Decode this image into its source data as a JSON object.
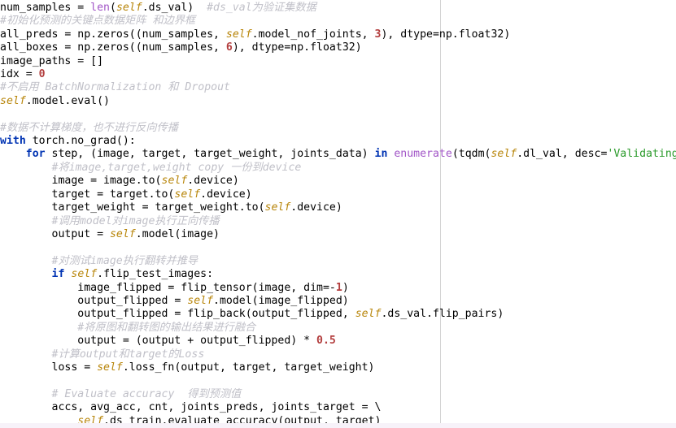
{
  "editor": {
    "app_name": "code-editor",
    "language": "python",
    "margin_ruler_column": 80,
    "colors": {
      "background": "#ffffff",
      "foreground": "#000000",
      "comment": "#c0c0c8",
      "keyword": "#0033b3",
      "self_variable": "#b8860b",
      "builtin": "#a256c7",
      "number": "#b33e3e",
      "string": "#2a9a2a",
      "ruler": "#d4d4d4",
      "bottom_band": "#f7f2f9"
    }
  },
  "code": {
    "lines": [
      [
        {
          "t": "num_samples = ",
          "c": "plain"
        },
        {
          "t": "len",
          "c": "builtin"
        },
        {
          "t": "(",
          "c": "plain"
        },
        {
          "t": "self",
          "c": "selfv"
        },
        {
          "t": ".ds_val)  ",
          "c": "plain"
        },
        {
          "t": "#ds_val为验证集数据",
          "c": "cmt"
        }
      ],
      [
        {
          "t": "#初始化预测的关键点数据矩阵 和边界框",
          "c": "cmt"
        }
      ],
      [
        {
          "t": "all_preds = np.zeros((num_samples, ",
          "c": "plain"
        },
        {
          "t": "self",
          "c": "selfv"
        },
        {
          "t": ".model_nof_joints, ",
          "c": "plain"
        },
        {
          "t": "3",
          "c": "num"
        },
        {
          "t": "), dtype=np.float32)",
          "c": "plain"
        }
      ],
      [
        {
          "t": "all_boxes = np.zeros((num_samples, ",
          "c": "plain"
        },
        {
          "t": "6",
          "c": "num"
        },
        {
          "t": "), dtype=np.float32)",
          "c": "plain"
        }
      ],
      [
        {
          "t": "image_paths = []",
          "c": "plain"
        }
      ],
      [
        {
          "t": "idx = ",
          "c": "plain"
        },
        {
          "t": "0",
          "c": "num"
        }
      ],
      [
        {
          "t": "#不启用 BatchNormalization 和 Dropout",
          "c": "cmt"
        }
      ],
      [
        {
          "t": "self",
          "c": "selfv"
        },
        {
          "t": ".model.eval()",
          "c": "plain"
        }
      ],
      [],
      [
        {
          "t": "#数据不计算梯度，也不进行反向传播",
          "c": "cmt"
        }
      ],
      [
        {
          "t": "with",
          "c": "kw"
        },
        {
          "t": " torch.no_grad():",
          "c": "plain"
        }
      ],
      [
        {
          "t": "    ",
          "c": "plain"
        },
        {
          "t": "for",
          "c": "kw"
        },
        {
          "t": " step, (image, target, target_weight, joints_data) ",
          "c": "plain"
        },
        {
          "t": "in",
          "c": "kw"
        },
        {
          "t": " ",
          "c": "plain"
        },
        {
          "t": "enumerate",
          "c": "builtin"
        },
        {
          "t": "(tqdm(",
          "c": "plain"
        },
        {
          "t": "self",
          "c": "selfv"
        },
        {
          "t": ".dl_val, desc=",
          "c": "plain"
        },
        {
          "t": "'Validating'",
          "c": "str"
        },
        {
          "t": ")):",
          "c": "plain"
        }
      ],
      [
        {
          "t": "        ",
          "c": "plain"
        },
        {
          "t": "#将image,target,weight copy 一份到device",
          "c": "cmt"
        }
      ],
      [
        {
          "t": "        image = image.to(",
          "c": "plain"
        },
        {
          "t": "self",
          "c": "selfv"
        },
        {
          "t": ".device)",
          "c": "plain"
        }
      ],
      [
        {
          "t": "        target = target.to(",
          "c": "plain"
        },
        {
          "t": "self",
          "c": "selfv"
        },
        {
          "t": ".device)",
          "c": "plain"
        }
      ],
      [
        {
          "t": "        target_weight = target_weight.to(",
          "c": "plain"
        },
        {
          "t": "self",
          "c": "selfv"
        },
        {
          "t": ".device)",
          "c": "plain"
        }
      ],
      [
        {
          "t": "        ",
          "c": "plain"
        },
        {
          "t": "#调用model对image执行正向传播",
          "c": "cmt"
        }
      ],
      [
        {
          "t": "        output = ",
          "c": "plain"
        },
        {
          "t": "self",
          "c": "selfv"
        },
        {
          "t": ".model(image)",
          "c": "plain"
        }
      ],
      [],
      [
        {
          "t": "        ",
          "c": "plain"
        },
        {
          "t": "#对测试image执行翻转并推导",
          "c": "cmt"
        }
      ],
      [
        {
          "t": "        ",
          "c": "plain"
        },
        {
          "t": "if",
          "c": "kw"
        },
        {
          "t": " ",
          "c": "plain"
        },
        {
          "t": "self",
          "c": "selfv"
        },
        {
          "t": ".flip_test_images:",
          "c": "plain"
        }
      ],
      [
        {
          "t": "            image_flipped = flip_tensor(image, dim=-",
          "c": "plain"
        },
        {
          "t": "1",
          "c": "num"
        },
        {
          "t": ")",
          "c": "plain"
        }
      ],
      [
        {
          "t": "            output_flipped = ",
          "c": "plain"
        },
        {
          "t": "self",
          "c": "selfv"
        },
        {
          "t": ".model(image_flipped)",
          "c": "plain"
        }
      ],
      [
        {
          "t": "            output_flipped = flip_back(output_flipped, ",
          "c": "plain"
        },
        {
          "t": "self",
          "c": "selfv"
        },
        {
          "t": ".ds_val.flip_pairs)",
          "c": "plain"
        }
      ],
      [
        {
          "t": "            ",
          "c": "plain"
        },
        {
          "t": "#将原图和翻转图的输出结果进行融合",
          "c": "cmt"
        }
      ],
      [
        {
          "t": "            output = (output + output_flipped) * ",
          "c": "plain"
        },
        {
          "t": "0.5",
          "c": "num"
        }
      ],
      [
        {
          "t": "        ",
          "c": "plain"
        },
        {
          "t": "#计算output和target的Loss",
          "c": "cmt"
        }
      ],
      [
        {
          "t": "        loss = ",
          "c": "plain"
        },
        {
          "t": "self",
          "c": "selfv"
        },
        {
          "t": ".loss_fn(output, target, target_weight)",
          "c": "plain"
        }
      ],
      [],
      [
        {
          "t": "        ",
          "c": "plain"
        },
        {
          "t": "# Evaluate accuracy  得到预测值",
          "c": "cmt"
        }
      ],
      [
        {
          "t": "        accs, avg_acc, cnt, joints_preds, joints_target = \\",
          "c": "plain"
        }
      ],
      [
        {
          "t": "            ",
          "c": "plain"
        },
        {
          "t": "self",
          "c": "selfv"
        },
        {
          "t": ".ds_train.evaluate_accuracy(output, target)",
          "c": "plain"
        }
      ]
    ]
  }
}
